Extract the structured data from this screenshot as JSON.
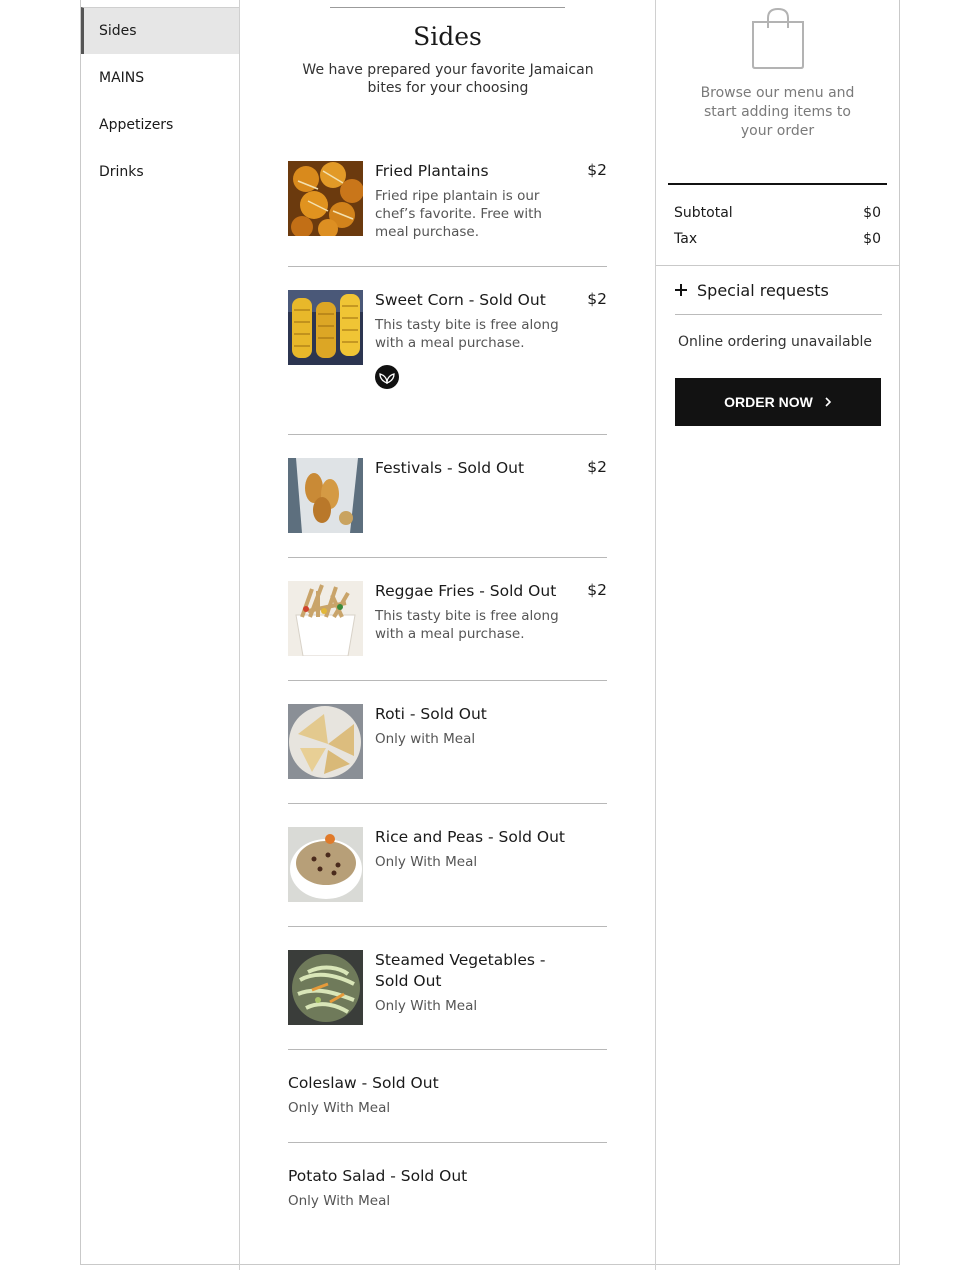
{
  "sidebar": {
    "items": [
      {
        "label": "Sides",
        "active": true
      },
      {
        "label": "MAINS"
      },
      {
        "label": "Appetizers"
      },
      {
        "label": "Drinks"
      }
    ]
  },
  "section": {
    "title": "Sides",
    "description": "We have prepared your favorite Jamaican bites for your choosing"
  },
  "items": [
    {
      "name": "Fried Plantains",
      "price": "$2",
      "description": "Fried ripe plantain is our chef’s favorite. Free with meal purchase.",
      "image": "fried-plantains-photo"
    },
    {
      "name": "Sweet Corn - Sold Out",
      "price": "$2",
      "description": "This tasty bite is free along with a meal purchase.",
      "image": "sweet-corn-photo",
      "badge": "vegetarian-leaf-icon"
    },
    {
      "name": "Festivals - Sold Out",
      "price": "$2",
      "description": "",
      "image": "festivals-photo"
    },
    {
      "name": "Reggae Fries - Sold Out",
      "price": "$2",
      "description": "This tasty bite is free along with a meal purchase.",
      "image": "reggae-fries-photo"
    },
    {
      "name": "Roti - Sold Out",
      "price": "",
      "description": "Only with Meal",
      "image": "roti-photo"
    },
    {
      "name": "Rice and Peas - Sold Out",
      "price": "",
      "description": "Only With Meal",
      "image": "rice-and-peas-photo"
    },
    {
      "name": "Steamed Vegetables - Sold Out",
      "price": "",
      "description": "Only With Meal",
      "image": "steamed-vegetables-photo"
    },
    {
      "name": "Coleslaw - Sold Out",
      "price": "",
      "description": "Only With Meal"
    },
    {
      "name": "Potato Salad - Sold Out",
      "price": "",
      "description": "Only With Meal"
    }
  ],
  "cart": {
    "icon": "shopping-bag-icon",
    "empty_message": "Browse our menu and start adding items to your order",
    "subtotal_label": "Subtotal",
    "subtotal_value": "$0",
    "tax_label": "Tax",
    "tax_value": "$0",
    "special_requests_label": "Special requests",
    "unavailable_message": "Online ordering unavailable",
    "order_button_label": "ORDER NOW"
  }
}
